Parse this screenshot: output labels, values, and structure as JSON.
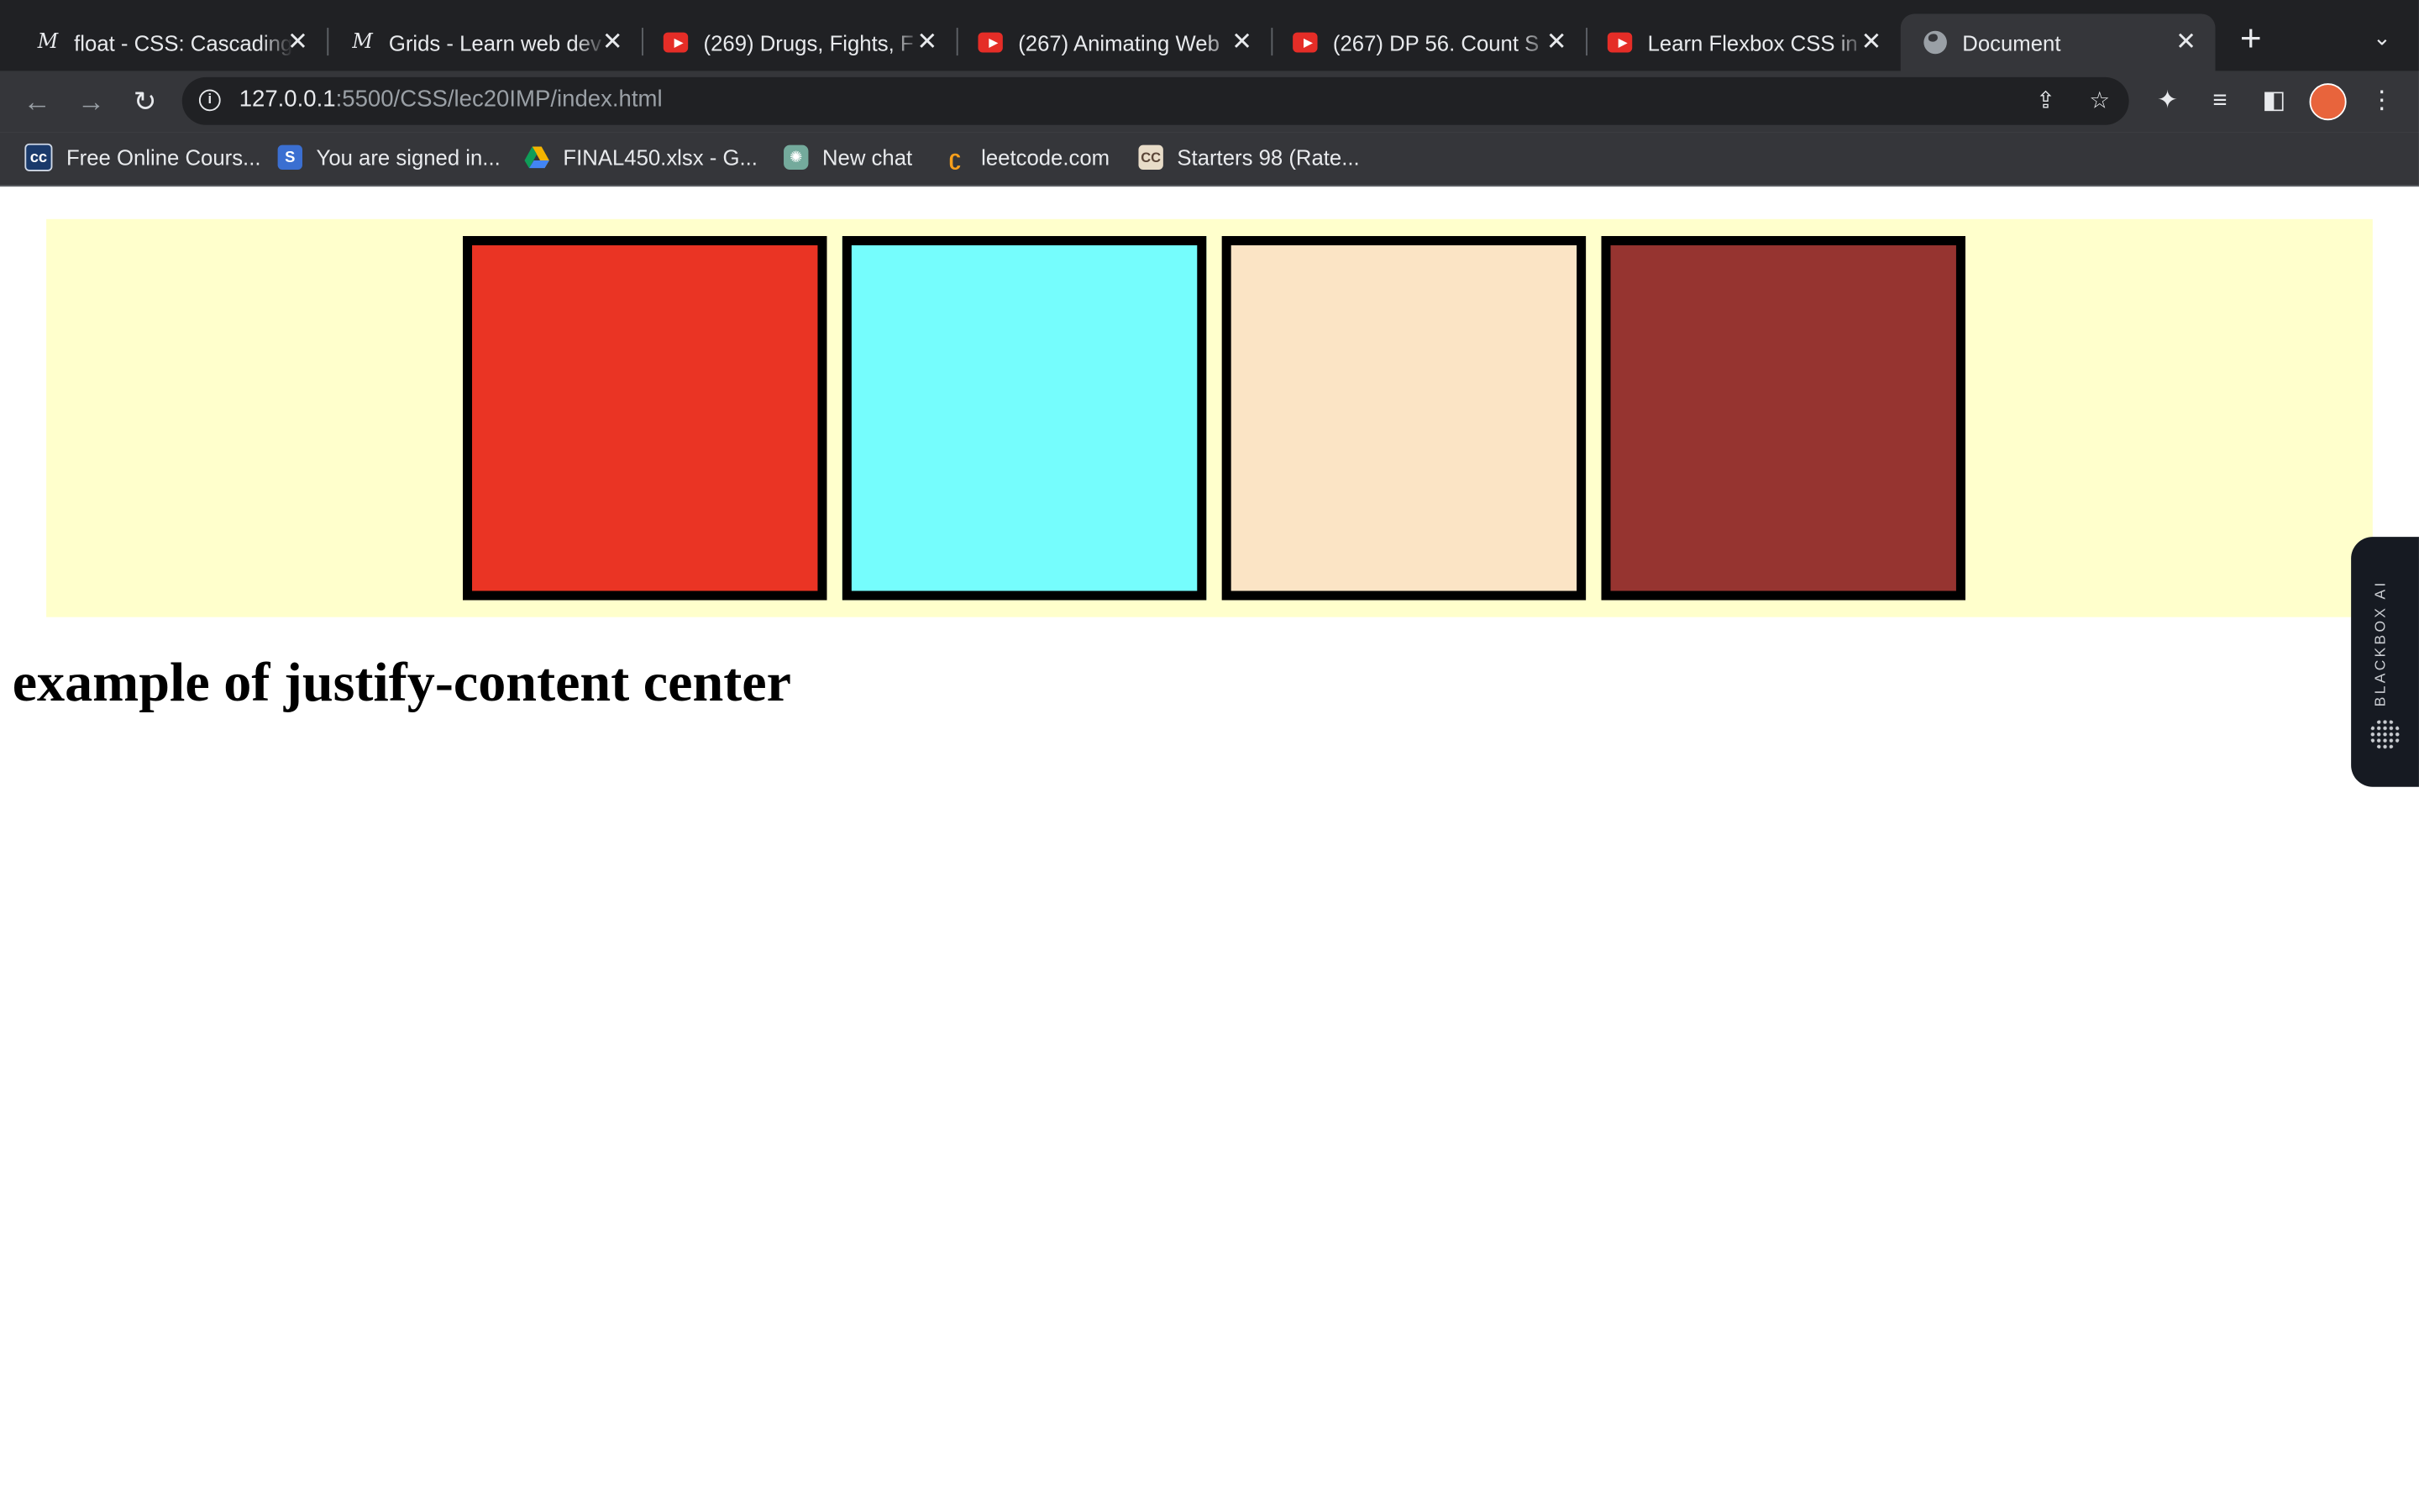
{
  "browser": {
    "tabs": [
      {
        "title": "float - CSS: Cascading",
        "icon": "mdn-icon"
      },
      {
        "title": "Grids - Learn web dev",
        "icon": "mdn-icon"
      },
      {
        "title": "(269) Drugs, Fights, F",
        "icon": "youtube-icon"
      },
      {
        "title": "(267) Animating Web",
        "icon": "youtube-icon"
      },
      {
        "title": "(267) DP 56. Count S",
        "icon": "youtube-icon"
      },
      {
        "title": "Learn Flexbox CSS in",
        "icon": "youtube-icon"
      },
      {
        "title": "Document",
        "icon": "globe-icon",
        "active": true
      }
    ],
    "tab_close_glyph": "✕",
    "new_tab_glyph": "+",
    "tab_search_glyph": "⌄",
    "address": {
      "host": "127.0.0.1",
      "path": ":5500/CSS/lec20IMP/index.html"
    },
    "bookmarks": [
      {
        "label": "Free Online Cours...",
        "icon": "cc-icon",
        "color": "#1a3a6b"
      },
      {
        "label": "You are signed in...",
        "icon": "s-icon",
        "color": "#3b6fd1"
      },
      {
        "label": "FINAL450.xlsx - G...",
        "icon": "google-drive-icon",
        "color": "#f4b400"
      },
      {
        "label": "New chat",
        "icon": "openai-icon",
        "color": "#74aa9c"
      },
      {
        "label": "leetcode.com",
        "icon": "leetcode-icon",
        "color": "#f89f1b"
      },
      {
        "label": "Starters 98 (Rate...",
        "icon": "codechef-icon",
        "color": "#5b4638"
      }
    ]
  },
  "page": {
    "boxes": [
      {
        "color": "#ea3424"
      },
      {
        "color": "#75fdfd"
      },
      {
        "color": "#fbe4c5"
      },
      {
        "color": "#963430"
      }
    ],
    "container_color": "#ffffcc",
    "heading": "example of justify-content center"
  },
  "widget": {
    "label": "BLACKBOX AI"
  }
}
